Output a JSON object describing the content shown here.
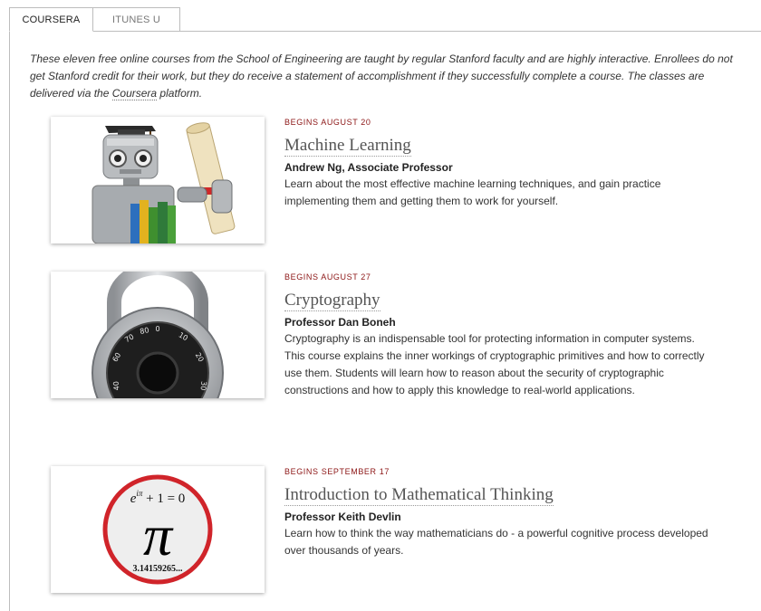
{
  "tabs": [
    {
      "label": "COURSERA",
      "active": true
    },
    {
      "label": "ITUNES U",
      "active": false
    }
  ],
  "intro": {
    "text_before_link": "These eleven free online courses from the School of Engineering are taught by regular Stanford faculty and are highly interactive. Enrollees do not get Stanford credit for their work, but they do receive a statement of accomplishment if they successfully complete a course. The classes are delivered via the ",
    "link_text": "Coursera",
    "text_after_link": " platform."
  },
  "courses": [
    {
      "begins": "BEGINS AUGUST 20",
      "title": "Machine Learning",
      "instructor": "Andrew Ng, Associate Professor",
      "description": "Learn about the most effective machine learning techniques, and gain practice implementing them and getting them to work for yourself.",
      "image": "robot-graduate-image"
    },
    {
      "begins": "BEGINS AUGUST 27",
      "title": "Cryptography",
      "instructor": "Professor Dan Boneh",
      "description": "Cryptography is an indispensable tool for protecting information in computer systems. This course explains the inner workings of cryptographic primitives and how to correctly use them. Students will learn how to reason about the security of cryptographic constructions and how to apply this knowledge to real-world applications.",
      "image": "combination-padlock-image",
      "dial_numbers": [
        "0",
        "10",
        "20",
        "30",
        "40",
        "60",
        "70",
        "80"
      ]
    },
    {
      "begins": "BEGINS SEPTEMBER 17",
      "title": "Introduction to Mathematical Thinking",
      "instructor": "Professor Keith Devlin",
      "description": "Learn how to think the way mathematicians do - a powerful cognitive process developed over thousands of years.",
      "image": "pi-circle-image",
      "image_formula_base": "e",
      "image_formula_exponent": "iπ",
      "image_formula_rest": " + 1 = 0",
      "image_symbol": "π",
      "image_digits": "3.14159265..."
    }
  ],
  "colors": {
    "accent": "#8c1515",
    "border": "#bdbdbd",
    "pi_ring": "#d0242a"
  }
}
